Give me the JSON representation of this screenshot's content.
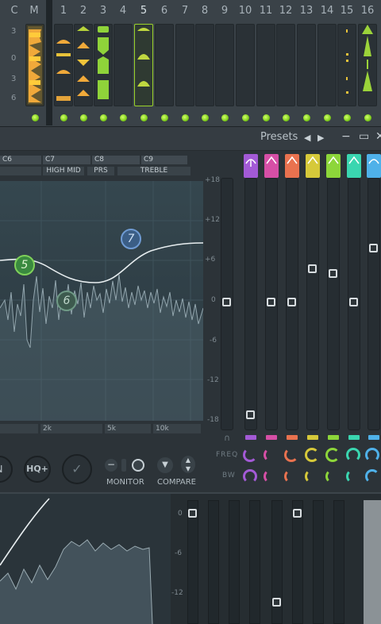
{
  "mixer": {
    "headers": [
      "C",
      "M",
      "1",
      "2",
      "3",
      "4",
      "5",
      "6",
      "7",
      "8",
      "9",
      "10",
      "11",
      "12",
      "13",
      "14",
      "15",
      "16"
    ],
    "active_channel": "5",
    "scale": [
      "3",
      "0",
      "3",
      "6"
    ]
  },
  "window": {
    "presets_label": "Presets",
    "prev_icon": "◀",
    "next_icon": "▶",
    "minimize_icon": "−",
    "maximize_icon": "▭",
    "close_icon": "✕"
  },
  "eq": {
    "band_labels": [
      "C6",
      "C7",
      "C8",
      "C9"
    ],
    "band_names": [
      "HIGH MID",
      "PRS",
      "TREBLE"
    ],
    "db_ticks": [
      "+18",
      "+12",
      "+6",
      "0",
      "-6",
      "-12",
      "-18"
    ],
    "freq_labels": [
      "2k",
      "5k",
      "10k"
    ],
    "bands": [
      "5",
      "6",
      "7"
    ],
    "row_labels": [
      "FREQ",
      "BW"
    ],
    "fader_colors": [
      "#a35ad6",
      "#d64fa6",
      "#e9724f",
      "#d6c93a",
      "#8dd63a",
      "#3ad6b0",
      "#4fb1e9"
    ]
  },
  "controls": {
    "hq_label": "HQ+",
    "monitor_label": "MONITOR",
    "compare_label": "COMPARE",
    "n_label": "N"
  },
  "bottom": {
    "db_ticks": [
      "0",
      "-6",
      "-12"
    ]
  }
}
